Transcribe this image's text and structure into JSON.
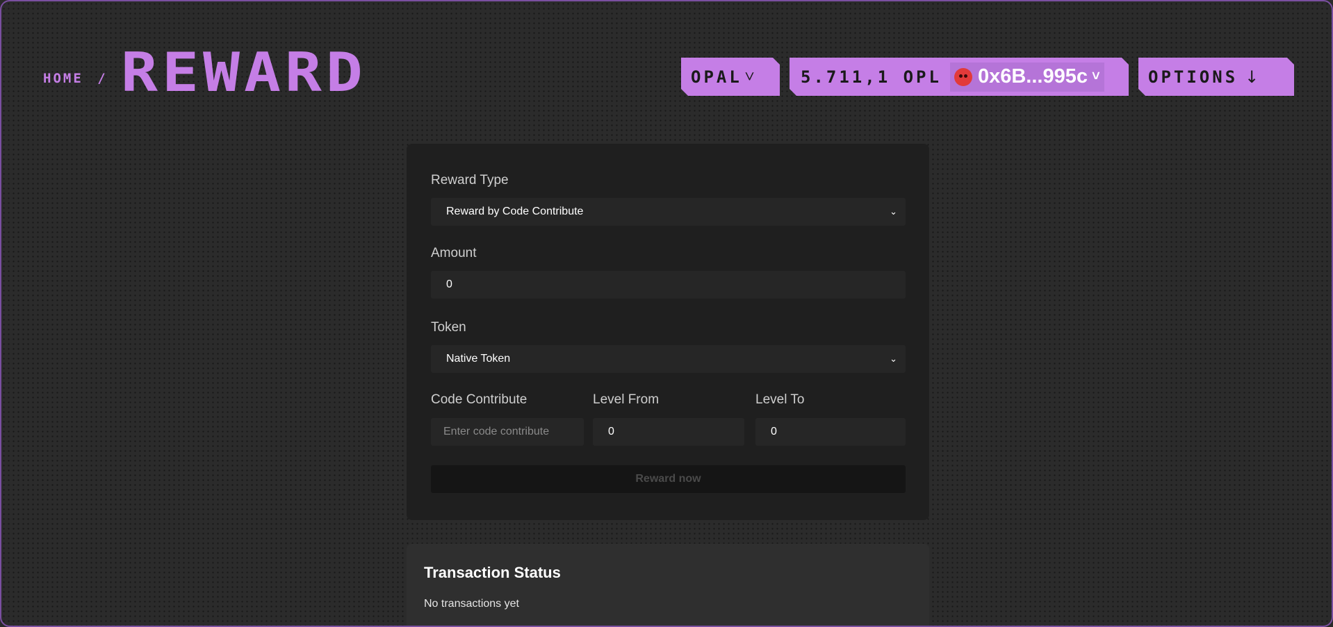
{
  "header": {
    "breadcrumb_home": "HOME",
    "breadcrumb_sep": "/",
    "title": "REWARD",
    "network_label": "OPAL",
    "balance": "5.711,1 OPL",
    "address": "0x6B...995c",
    "options_label": "OPTIONS",
    "accent_color": "#c57ee6"
  },
  "form": {
    "reward_type": {
      "label": "Reward Type",
      "selected": "Reward by Code Contribute"
    },
    "amount": {
      "label": "Amount",
      "value": "0"
    },
    "token": {
      "label": "Token",
      "selected": "Native Token"
    },
    "code_contribute": {
      "label": "Code Contribute",
      "placeholder": "Enter code contribute"
    },
    "level_from": {
      "label": "Level From",
      "value": "0"
    },
    "level_to": {
      "label": "Level To",
      "value": "0"
    },
    "submit_label": "Reward now"
  },
  "transactions": {
    "title": "Transaction Status",
    "empty_text": "No transactions yet"
  }
}
